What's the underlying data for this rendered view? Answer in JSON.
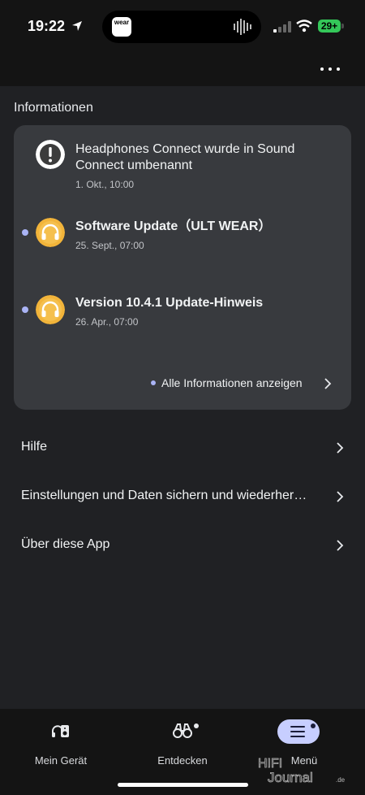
{
  "status_bar": {
    "time": "19:22",
    "battery": "29+",
    "island_app_label": "wear"
  },
  "section_title": "Informationen",
  "info_items": [
    {
      "title": "Headphones Connect wurde in Sound Connect umbenannt",
      "date": "1. Okt., 10:00",
      "icon": "alert-icon",
      "unread": false
    },
    {
      "title": "Software Update（ULT WEAR）",
      "date": "25. Sept., 07:00",
      "icon": "headphones-icon",
      "unread": true
    },
    {
      "title": "Version 10.4.1 Update-Hinweis",
      "date": "26. Apr., 07:00",
      "icon": "headphones-icon",
      "unread": true
    }
  ],
  "all_info_link": "Alle Informationen anzeigen",
  "menu_items": [
    {
      "label": "Hilfe"
    },
    {
      "label": "Einstellungen und Daten sichern und wiederher…"
    },
    {
      "label": "Über diese App"
    }
  ],
  "bottom_nav": [
    {
      "label": "Mein Gerät",
      "icon": "device-icon"
    },
    {
      "label": "Entdecken",
      "icon": "binoculars-icon"
    },
    {
      "label": "Menü",
      "icon": "menu-icon",
      "active": true
    }
  ],
  "watermark": "HIFI Journal.de",
  "colors": {
    "background": "#202124",
    "card": "#383a3e",
    "accent_dot": "#aab4f5",
    "active_pill": "#c7ceff",
    "headphones_icon": "#f2b43a",
    "battery": "#34c759"
  }
}
